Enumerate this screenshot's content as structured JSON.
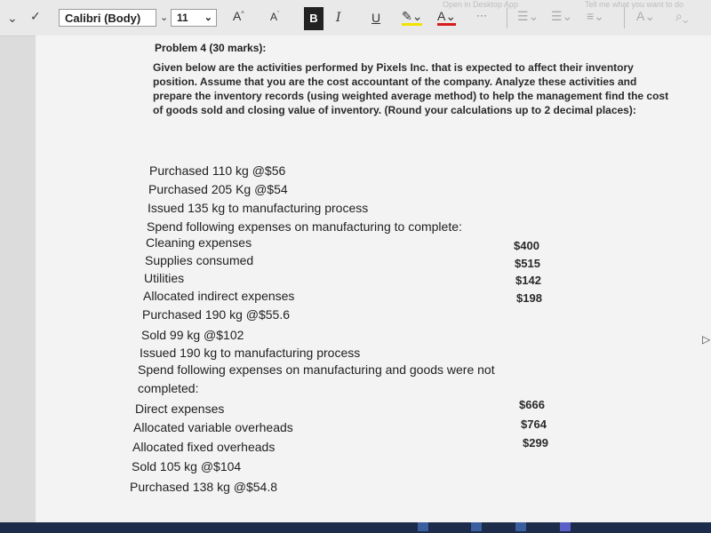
{
  "toolbar": {
    "font_name": "Calibri (Body)",
    "font_size": "11",
    "grow_font": "A",
    "shrink_font": "A",
    "bold": "B",
    "italic": "I",
    "underline": "U",
    "open_desktop": "Open in Desktop App",
    "tell_me": "Tell me what you want to do"
  },
  "document": {
    "problem_title": "Problem 4 (30 marks):",
    "intro": "Given below are the activities performed by Pixels Inc. that is expected to affect their inventory position. Assume that you are the cost accountant of the company. Analyze these activities and prepare the inventory records (using weighted average method) to help the management find the cost of goods sold and closing value of inventory. (Round your calculations up to 2 decimal places):",
    "lines": [
      "Purchased 110 kg @$56",
      "Purchased 205 Kg @$54",
      "Issued 135 kg to manufacturing process",
      "Spend following expenses on manufacturing to complete:",
      "Cleaning expenses",
      "Supplies consumed",
      "Utilities",
      "Allocated indirect expenses",
      "Purchased 190 kg @$55.6",
      "Sold 99 kg @$102",
      "Issued 190 kg to manufacturing process",
      "Spend following expenses on manufacturing and goods were not completed:",
      "Direct expenses",
      "Allocated variable overheads",
      "Allocated fixed overheads",
      "Sold 105 kg @$104",
      "Purchased 138 kg @$54.8"
    ],
    "amounts_group1": [
      "$400",
      "$515",
      "$142",
      "$198"
    ],
    "amounts_group2": [
      "$666",
      "$764",
      "$299"
    ]
  }
}
